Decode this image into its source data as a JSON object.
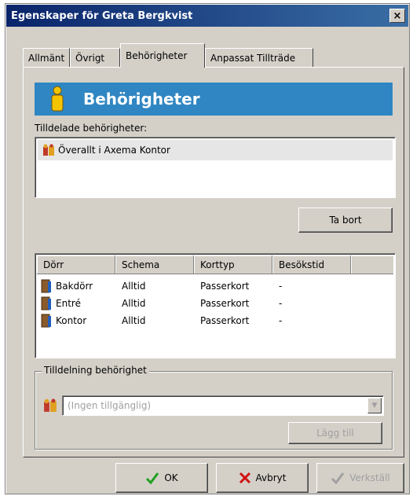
{
  "window": {
    "title": "Egenskaper för Greta Bergkvist",
    "close_glyph": "×"
  },
  "tabs": [
    {
      "label": "Allmänt"
    },
    {
      "label": "Övrigt"
    },
    {
      "label": "Behörigheter",
      "active": true
    },
    {
      "label": "Anpassat Tillträde"
    }
  ],
  "banner": {
    "title": "Behörigheter",
    "icon": "person-icon",
    "color": "#2f86c2"
  },
  "assigned": {
    "label": "Tilldelade behörigheter:",
    "items": [
      {
        "text": "Överallt i Axema Kontor",
        "icon": "group-icon"
      }
    ],
    "remove_label": "Ta bort"
  },
  "doors": {
    "columns": [
      "Dörr",
      "Schema",
      "Korttyp",
      "Besökstid"
    ],
    "rows": [
      {
        "door": "Bakdörr",
        "schema": "Alltid",
        "card": "Passerkort",
        "visit": "-"
      },
      {
        "door": "Entré",
        "schema": "Alltid",
        "card": "Passerkort",
        "visit": "-"
      },
      {
        "door": "Kontor",
        "schema": "Alltid",
        "card": "Passerkort",
        "visit": "-"
      }
    ]
  },
  "assign": {
    "legend": "Tilldelning behörighet",
    "combo_value": "(Ingen tillgänglig)",
    "add_label": "Lägg till"
  },
  "buttons": {
    "ok": "OK",
    "cancel": "Avbryt",
    "apply": "Verkställ"
  }
}
